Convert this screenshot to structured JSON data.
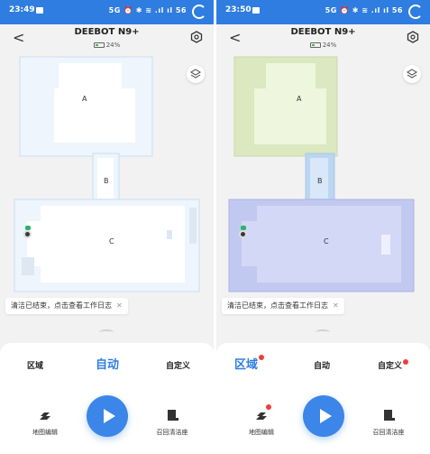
{
  "screens": [
    {
      "status": {
        "time": "23:49",
        "indicators": "5G ⏰ ✱ ≋ .ıl ıl 56"
      },
      "header": {
        "back": "<",
        "title": "DEEBOT N9+",
        "battery": "24%"
      },
      "rooms": {
        "a": "A",
        "b": "B",
        "c": "C"
      },
      "toast": {
        "text": "清洁已结束，点击查看工作日志",
        "close": "✕"
      },
      "modes": {
        "area": "区域",
        "auto": "自动",
        "custom": "自定义"
      },
      "actions": {
        "map_edit": "地图编辑",
        "recall": "召回清洁座"
      }
    },
    {
      "status": {
        "time": "23:50",
        "indicators": "5G ⏰ ✱ ≋ .ıl ıl 56"
      },
      "header": {
        "back": "<",
        "title": "DEEBOT N9+",
        "battery": "24%"
      },
      "rooms": {
        "a": "A",
        "b": "B",
        "c": "C"
      },
      "toast": {
        "text": "清洁已结束，点击查看工作日志",
        "close": "✕"
      },
      "modes": {
        "area": "区域",
        "auto": "自动",
        "custom": "自定义"
      },
      "actions": {
        "map_edit": "地图编辑",
        "recall": "召回清洁座"
      }
    }
  ],
  "colors": {
    "status_bar": "#2f7de1",
    "accent": "#3b86e8",
    "badge": "#f23c3c",
    "room_a_right": "#e9f4d4",
    "room_b_right": "#cfe3f7",
    "room_c_right": "#cdd3f5",
    "room_left": "#eef5fc"
  }
}
